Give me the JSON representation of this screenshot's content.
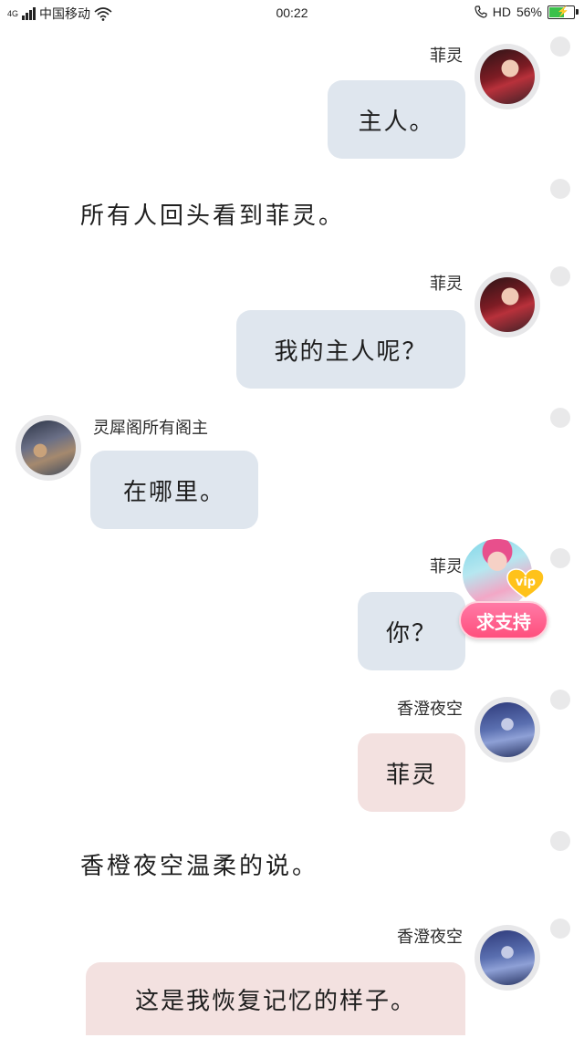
{
  "status_bar": {
    "network": "4G",
    "carrier": "中国移动",
    "time": "00:22",
    "hd": "HD",
    "battery_percent": "56%",
    "battery_level": 0.56,
    "battery_color": "#3ac14a"
  },
  "messages": [
    {
      "kind": "bubble",
      "side": "right",
      "name": "菲灵",
      "text": "主人。",
      "bubble_color": "#dfe6ee",
      "avatar": "feiling"
    },
    {
      "kind": "narration",
      "text": "所有人回头看到菲灵。"
    },
    {
      "kind": "bubble",
      "side": "right",
      "name": "菲灵",
      "text": "我的主人呢？",
      "bubble_color": "#dfe6ee",
      "avatar": "feiling"
    },
    {
      "kind": "bubble",
      "side": "left",
      "name": "灵犀阁所有阁主",
      "text": "在哪里。",
      "bubble_color": "#dfe6ee",
      "avatar": "lingxi"
    },
    {
      "kind": "bubble",
      "side": "right",
      "name": "菲灵",
      "text": "你？",
      "bubble_color": "#dfe6ee",
      "avatar": "feiling"
    },
    {
      "kind": "bubble",
      "side": "right",
      "name": "香澄夜空",
      "text": "菲灵",
      "bubble_color": "#f3e1e0",
      "avatar": "xiangcheng"
    },
    {
      "kind": "narration",
      "text": "香橙夜空温柔的说。"
    },
    {
      "kind": "bubble",
      "side": "right",
      "name": "香澄夜空",
      "text": "这是我恢复记忆的样子。",
      "bubble_color": "#f3e1e0",
      "avatar": "xiangcheng"
    }
  ],
  "vip_float": {
    "badge": "vip",
    "button_label": "求支持"
  }
}
